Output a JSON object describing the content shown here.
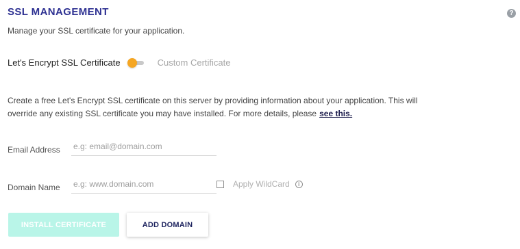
{
  "header": {
    "title": "SSL MANAGEMENT",
    "subtitle": "Manage your SSL certificate for your application.",
    "help_icon": "?"
  },
  "certificate_toggle": {
    "left_label": "Let's Encrypt SSL Certificate",
    "right_label": "Custom Certificate",
    "selected": "Let's Encrypt SSL Certificate",
    "accent_color": "#f5a623"
  },
  "description": {
    "text": "Create a free Let's Encrypt SSL certificate on this server by providing information about your application. This will override any existing SSL certificate you may have installed. For more details, please",
    "link_text": "see this."
  },
  "form": {
    "email_label": "Email Address",
    "email_placeholder": "e.g: email@domain.com",
    "email_value": "",
    "domain_label": "Domain Name",
    "domain_placeholder": "e.g: www.domain.com",
    "domain_value": "",
    "wildcard_label": "Apply WildCard",
    "wildcard_checked": false
  },
  "buttons": {
    "install_label": "INSTALL CERTIFICATE",
    "add_domain_label": "ADD DOMAIN"
  }
}
